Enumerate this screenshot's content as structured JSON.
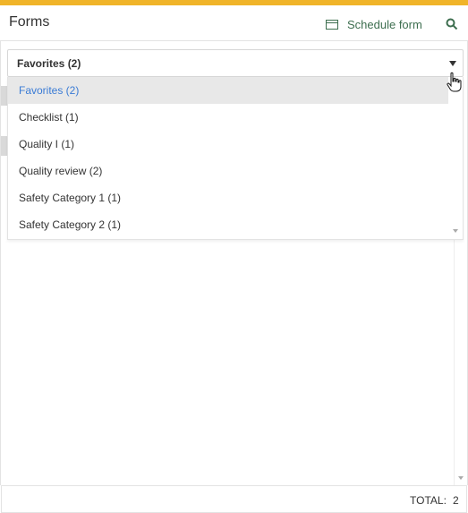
{
  "header": {
    "title": "Forms",
    "schedule_label": "Schedule form",
    "schedule_icon": "calendar-icon",
    "search_icon": "search-icon"
  },
  "category_select": {
    "selected": "Favorites (2)",
    "options": [
      "Favorites (2)",
      "Checklist (1)",
      "Quality I (1)",
      "Quality review (2)",
      "Safety Category 1 (1)",
      "Safety Category 2 (1)"
    ]
  },
  "footer": {
    "total_label": "TOTAL:",
    "total_value": "2"
  },
  "colors": {
    "accent": "#f0b429",
    "link_green": "#3d6e4f",
    "selected_text": "#3a7bd5",
    "selected_bg": "#e8e8e8"
  }
}
